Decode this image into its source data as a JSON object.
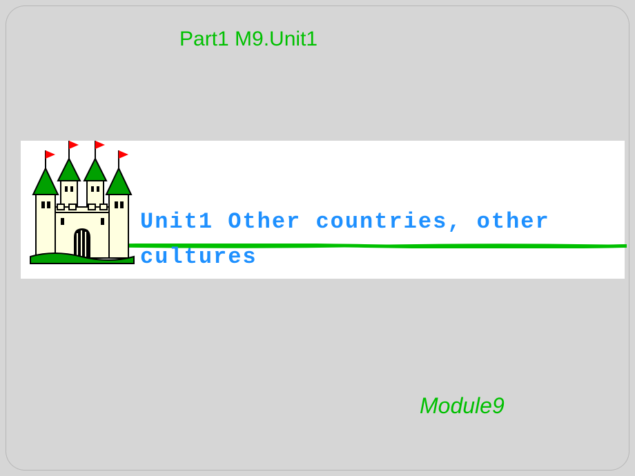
{
  "header": {
    "text": "Part1 M9.Unit1"
  },
  "title": {
    "line1": "Unit1  Other countries, other",
    "line2": "cultures"
  },
  "footer": {
    "module": "Module9"
  },
  "colors": {
    "green": "#00c000",
    "blue": "#1e90ff",
    "bg": "#d6d6d6"
  },
  "icons": {
    "castle": "castle-icon"
  }
}
